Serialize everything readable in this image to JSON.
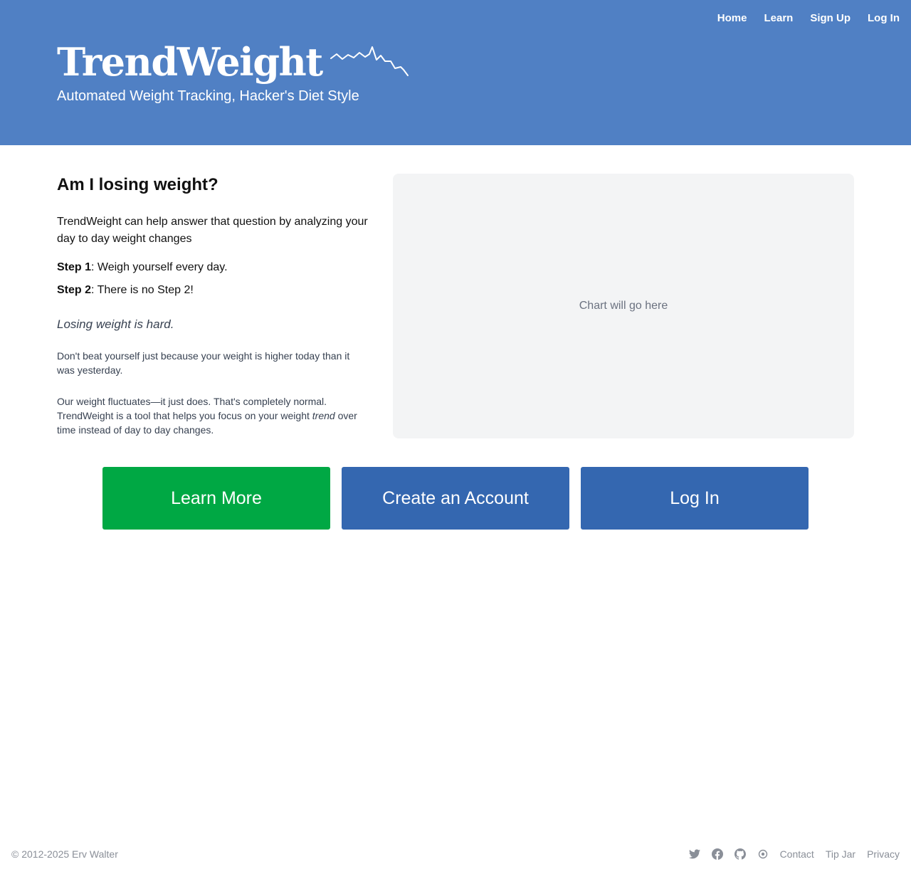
{
  "nav": {
    "home": "Home",
    "learn": "Learn",
    "signup": "Sign Up",
    "login": "Log In"
  },
  "brand": {
    "name": "TrendWeight",
    "tagline": "Automated Weight Tracking, Hacker's Diet Style",
    "sparkline_icon": "weight-sparkline-icon"
  },
  "intro": {
    "heading": "Am I losing weight?",
    "text": "TrendWeight can help answer that question by analyzing your day to day weight changes",
    "step1_label": "Step 1",
    "step1_text": ": Weigh yourself every day.",
    "step2_label": "Step 2",
    "step2_text": ": There is no Step 2!",
    "hard": "Losing weight is hard.",
    "note1": "Don't beat yourself just because your weight is higher today than it was yesterday.",
    "note2_a": "Our weight fluctuates—it just does. That's completely normal. TrendWeight is a tool that helps you focus on your weight ",
    "note2_em": "trend",
    "note2_b": " over time instead of day to day changes."
  },
  "chart": {
    "placeholder": "Chart will go here"
  },
  "cta": {
    "learn_more": "Learn More",
    "create_account": "Create an Account",
    "login": "Log In"
  },
  "footer": {
    "copyright": "© 2012-2025 Erv Walter",
    "icons": [
      "twitter-icon",
      "facebook-icon",
      "github-icon",
      "target-icon"
    ],
    "contact": "Contact",
    "tip_jar": "Tip Jar",
    "privacy": "Privacy"
  },
  "colors": {
    "header": "#5080c4",
    "learn_button": "#00a844",
    "primary_button": "#3467b0",
    "chart_bg": "#f3f4f5"
  }
}
